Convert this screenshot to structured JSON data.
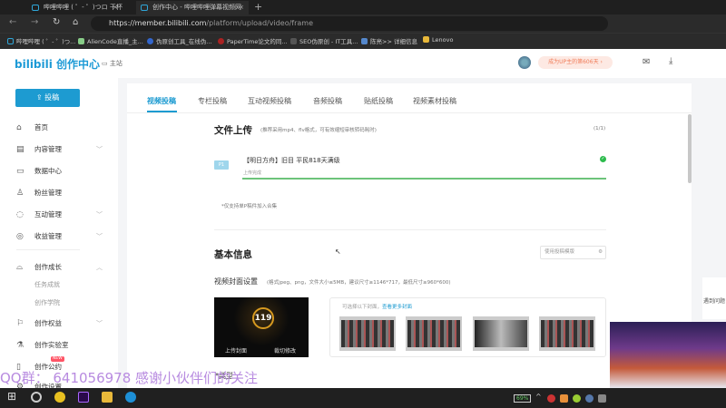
{
  "browser": {
    "tabs": [
      {
        "title": "哔哩哔哩 ( ゜- ゜)つロ 干杯~-bili"
      },
      {
        "title": "创作中心 - 哔哩哔哩弹幕视频网"
      }
    ],
    "url_host": "https://member.bilibili.com",
    "url_path": "/platform/upload/video/frame",
    "bookmarks": [
      "哔哩哔哩 ( ゜- ゜)つ...",
      "AlienCode直播_主...",
      "伪原创工具_在线伪...",
      "PaperTime论文的同...",
      "SEO伪原创 - IT工具...",
      "陈亮>> 详细信息",
      "Lenovo"
    ]
  },
  "header": {
    "logo": "bilibili 创作中心",
    "home": "主站",
    "up_badge": "成为UP主的第606天 ›"
  },
  "sidebar": {
    "post_button": "投稿",
    "items": [
      {
        "label": "首页",
        "icon": "⌂"
      },
      {
        "label": "内容管理",
        "icon": "▤",
        "chev": "﹀"
      },
      {
        "label": "数据中心",
        "icon": "▭"
      },
      {
        "label": "粉丝管理",
        "icon": "♙"
      },
      {
        "label": "互动管理",
        "icon": "◌",
        "chev": "﹀"
      },
      {
        "label": "收益管理",
        "icon": "◎",
        "chev": "﹀"
      },
      {
        "label": "创作成长",
        "icon": "⌓",
        "chev": "︿"
      },
      {
        "label": "创作权益",
        "icon": "⚐",
        "chev": "﹀"
      },
      {
        "label": "创作实验室",
        "icon": "⚗"
      },
      {
        "label": "创作公约",
        "icon": "▯",
        "badge": "NEW"
      },
      {
        "label": "创作设置",
        "icon": "⚙"
      }
    ],
    "sub_items": [
      "任务成就",
      "创作学院"
    ]
  },
  "main": {
    "tabs": [
      "视频投稿",
      "专栏投稿",
      "互动视频投稿",
      "音频投稿",
      "贴纸投稿",
      "视频素材投稿"
    ],
    "upload": {
      "title": "文件上传",
      "hint": "(推荐采用mp4、flv格式，可有效缩短审核转码耗时)",
      "count": "(1/1)",
      "part": "P1",
      "file_name": "【明日方舟】旧目 平民818天满级",
      "status": "上传完成",
      "note": "*仅支持单P稿件加入合集"
    },
    "basic": {
      "title": "基本信息",
      "template": "使用投稿模版",
      "cover_title": "视频封面设置",
      "cover_hint": "(格式jpeg、png，文件大小≤5MB，建议尺寸≥1146*717，最低尺寸≥960*600)",
      "cover_number": "119",
      "upload_cover": "上传封面",
      "crop_cover": "裁切修改",
      "choose_hint": "可选择以下封面，",
      "more_covers": "查看更多封面",
      "next_label": "*类型"
    }
  },
  "help": "遇到问题",
  "overlay_text": "QQ群： 641056978 感谢小伙伴们的关注",
  "tray": {
    "battery": "69%"
  },
  "colors": {
    "accent": "#1d9bd1",
    "success": "#2dbb4d"
  }
}
